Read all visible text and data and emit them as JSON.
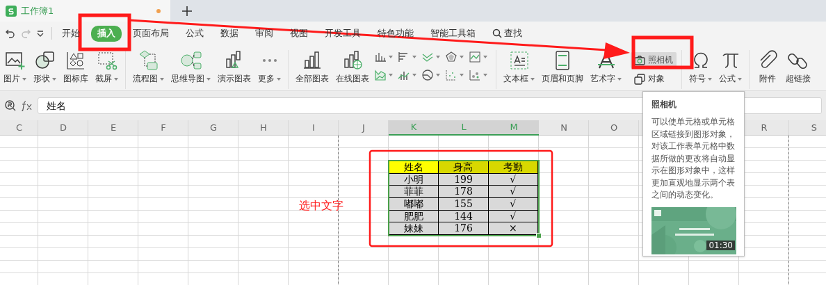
{
  "tabs": [
    {
      "label": "工作簿1",
      "selected": true,
      "unsaved": true
    }
  ],
  "menu": [
    {
      "label": "开始",
      "selected": false
    },
    {
      "label": "插入",
      "selected": true
    },
    {
      "label": "页面布局",
      "selected": false
    },
    {
      "label": "公式",
      "selected": false
    },
    {
      "label": "数据",
      "selected": false
    },
    {
      "label": "审阅",
      "selected": false
    },
    {
      "label": "视图",
      "selected": false
    },
    {
      "label": "开发工具",
      "selected": false
    },
    {
      "label": "特色功能",
      "selected": false
    },
    {
      "label": "智能工具箱",
      "selected": false
    }
  ],
  "search": {
    "label": "查找"
  },
  "toolbar_groups": [
    [
      {
        "label": "图片",
        "dropdown": true
      },
      {
        "label": "形状",
        "dropdown": true
      },
      {
        "label": "图标库",
        "dropdown": false
      },
      {
        "label": "截屏",
        "dropdown": true
      }
    ],
    [
      {
        "label": "流程图",
        "dropdown": true
      },
      {
        "label": "思维导图",
        "dropdown": true
      },
      {
        "label": "演示图表",
        "dropdown": false
      },
      {
        "label": "更多",
        "dropdown": true
      }
    ],
    [
      {
        "label": "全部图表",
        "dropdown": false
      },
      {
        "label": "在线图表",
        "dropdown": false
      }
    ],
    [
      {
        "label": "文本框",
        "dropdown": true
      },
      {
        "label": "页眉和页脚",
        "dropdown": false
      },
      {
        "label": "艺术字",
        "dropdown": true
      }
    ],
    [
      {
        "label": "符号",
        "dropdown": true
      },
      {
        "label": "公式",
        "dropdown": true
      }
    ],
    [
      {
        "label": "附件",
        "dropdown": false
      },
      {
        "label": "超链接",
        "dropdown": false
      }
    ]
  ],
  "camera": {
    "label": "照相机",
    "highlighted": true
  },
  "object": {
    "label": "对象"
  },
  "formula_bar": {
    "value": "姓名"
  },
  "columns": [
    {
      "label": "C",
      "selected": false
    },
    {
      "label": "D",
      "selected": false
    },
    {
      "label": "E",
      "selected": false
    },
    {
      "label": "F",
      "selected": false
    },
    {
      "label": "G",
      "selected": false
    },
    {
      "label": "H",
      "selected": false
    },
    {
      "label": "I",
      "selected": false
    },
    {
      "label": "J",
      "selected": false
    },
    {
      "label": "K",
      "selected": true
    },
    {
      "label": "L",
      "selected": true
    },
    {
      "label": "M",
      "selected": true
    },
    {
      "label": "N",
      "selected": false
    },
    {
      "label": "O",
      "selected": false
    },
    {
      "label": "R",
      "selected": false
    },
    {
      "label": "S",
      "selected": false
    }
  ],
  "table": {
    "header": [
      {
        "label": "姓名",
        "color": "#ffff00"
      },
      {
        "label": "身高",
        "color": "#d8d800"
      },
      {
        "label": "考勤",
        "color": "#d8d800"
      }
    ],
    "rows": [
      [
        "小明",
        "199",
        "√"
      ],
      [
        "菲菲",
        "178",
        "√"
      ],
      [
        "嘟嘟",
        "155",
        "√"
      ],
      [
        "肥肥",
        "144",
        "√"
      ],
      [
        "妹妹",
        "176",
        "×"
      ]
    ]
  },
  "annotation": {
    "text": "选中文字"
  },
  "tooltip": {
    "title": "照相机",
    "body": "可以使单元格或单元格区域链接到图形对象，对该工作表单元格中数据所做的更改将自动显示在图形对象中，这样更加直观地显示两个表之间的动态变化。",
    "video": {
      "kind": "picture",
      "duration": "01:30"
    }
  }
}
